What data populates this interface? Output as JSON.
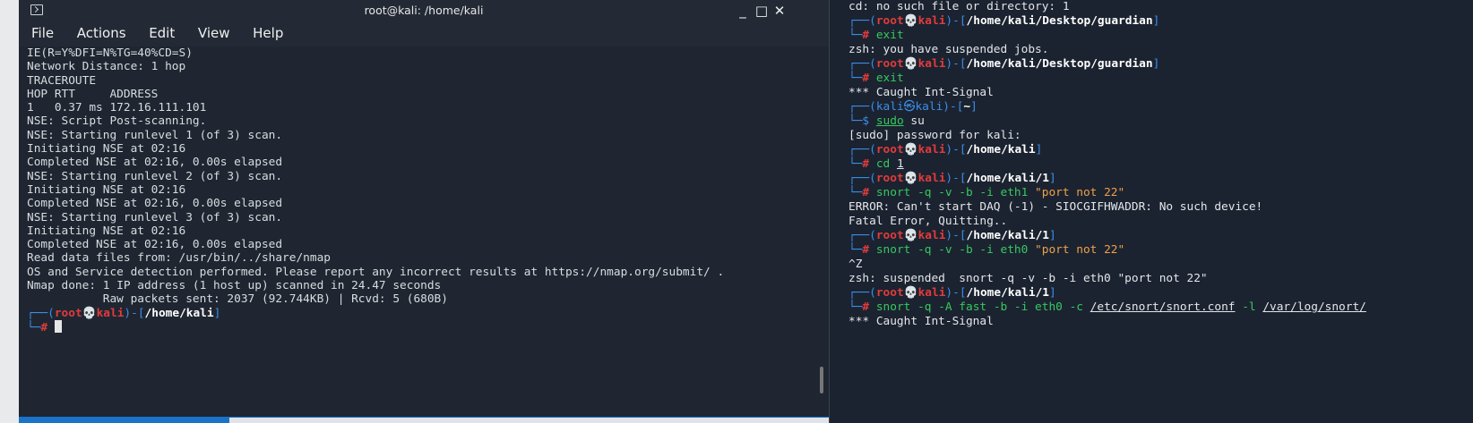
{
  "window": {
    "title": "root@kali: /home/kali",
    "minimize": "_",
    "maximize": "□",
    "close": "✕"
  },
  "menu": [
    "File",
    "Actions",
    "Edit",
    "View",
    "Help"
  ],
  "left_terminal": {
    "lines": [
      "IE(R=Y%DFI=N%TG=40%CD=S)",
      "",
      "Network Distance: 1 hop",
      "",
      "TRACEROUTE",
      "HOP RTT     ADDRESS",
      "1   0.37 ms 172.16.111.101",
      "",
      "NSE: Script Post-scanning.",
      "NSE: Starting runlevel 1 (of 3) scan.",
      "Initiating NSE at 02:16",
      "Completed NSE at 02:16, 0.00s elapsed",
      "NSE: Starting runlevel 2 (of 3) scan.",
      "Initiating NSE at 02:16",
      "Completed NSE at 02:16, 0.00s elapsed",
      "NSE: Starting runlevel 3 (of 3) scan.",
      "Initiating NSE at 02:16",
      "Completed NSE at 02:16, 0.00s elapsed",
      "Read data files from: /usr/bin/../share/nmap",
      "OS and Service detection performed. Please report any incorrect results at https://nmap.org/submit/ .",
      "Nmap done: 1 IP address (1 host up) scanned in 24.47 seconds",
      "           Raw packets sent: 2037 (92.744KB) | Rcvd: 5 (680B)"
    ],
    "prompt": {
      "user": "root",
      "host": "kali",
      "path": "/home/kali"
    }
  },
  "right_terminal": {
    "first_line": "cd: no such file or directory: 1",
    "blocks": [
      {
        "user": "root",
        "host": "kali",
        "path": "/home/kali/Desktop/guardian",
        "cmd": "exit",
        "output": [
          "zsh: you have suspended jobs."
        ]
      },
      {
        "user": "root",
        "host": "kali",
        "path": "/home/kali/Desktop/guardian",
        "cmd": "exit",
        "output": [
          "*** Caught Int-Signal"
        ]
      },
      {
        "user": "kali",
        "host": "kali",
        "path": "~",
        "cmd_a": "sudo",
        "cmd_b": " su",
        "output": [
          "[sudo] password for kali:"
        ]
      },
      {
        "user": "root",
        "host": "kali",
        "path": "/home/kali",
        "cmd_a": "cd ",
        "cmd_b": "1",
        "output": []
      },
      {
        "user": "root",
        "host": "kali",
        "path": "/home/kali/1",
        "cmd": "snort -q -v -b -i eth1 ",
        "arg": "\"port not 22\"",
        "output": [
          "ERROR: Can't start DAQ (-1) - SIOCGIFHWADDR: No such device!",
          "Fatal Error, Quitting.."
        ]
      },
      {
        "user": "root",
        "host": "kali",
        "path": "/home/kali/1",
        "cmd": "snort -q -v -b -i eth0 ",
        "arg": "\"port not 22\"",
        "output": [
          "^Z",
          "zsh: suspended  snort -q -v -b -i eth0 \"port not 22\""
        ]
      },
      {
        "user": "root",
        "host": "kali",
        "path": "/home/kali/1",
        "cmd_c": "snort -q -A fast -b -i eth0 -c ",
        "conf": "/etc/snort/snort.conf",
        "mid": " -l ",
        "logdir": "/var/log/snort/",
        "output": [
          "*** Caught Int-Signal"
        ]
      }
    ]
  },
  "colors": {
    "prompt_frame": "#3b8eea",
    "root_user": "#e23b3b",
    "kali_user": "#3b8eea",
    "command": "#36c95f",
    "string_arg": "#f0a04b"
  }
}
